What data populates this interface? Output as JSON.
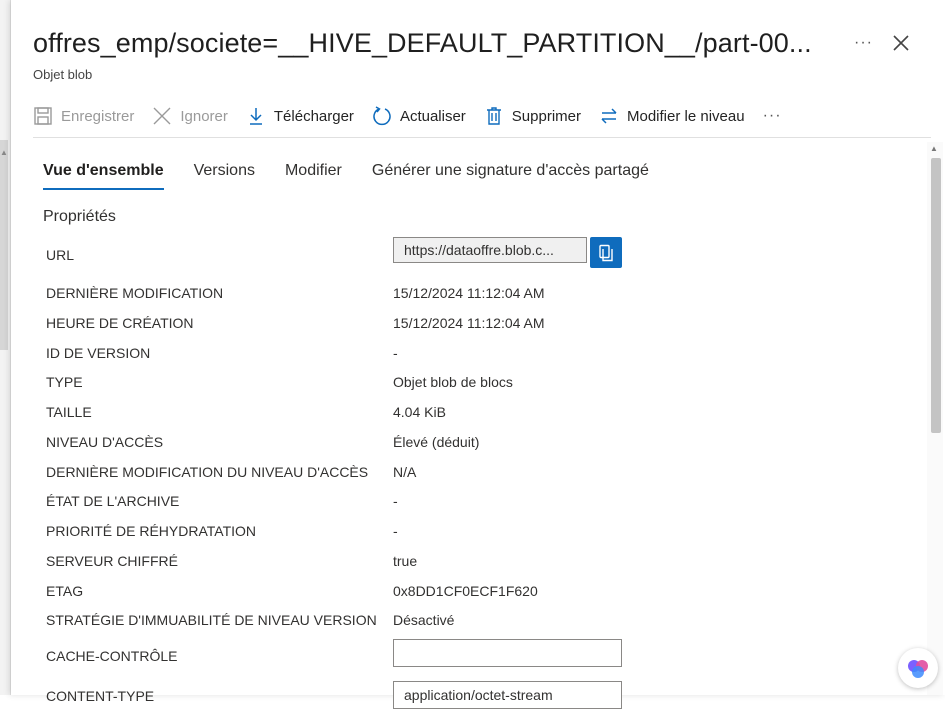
{
  "window": {
    "title": "offres_emp/societe=__HIVE_DEFAULT_PARTITION__/part-00...",
    "subtitle": "Objet blob"
  },
  "toolbar": {
    "save_label": "Enregistrer",
    "discard_label": "Ignorer",
    "download_label": "Télécharger",
    "refresh_label": "Actualiser",
    "delete_label": "Supprimer",
    "change_tier_label": "Modifier le niveau"
  },
  "tabs": [
    {
      "label": "Vue d'ensemble",
      "active": true
    },
    {
      "label": "Versions",
      "active": false
    },
    {
      "label": "Modifier",
      "active": false
    },
    {
      "label": "Générer une signature d'accès partagé",
      "active": false
    }
  ],
  "section_title": "Propriétés",
  "properties": {
    "url": {
      "label": "URL",
      "value": "https://dataoffre.blob.c..."
    },
    "last_modified": {
      "label": "DERNIÈRE MODIFICATION",
      "value": "15/12/2024 11:12:04 AM"
    },
    "creation_time": {
      "label": "HEURE DE CRÉATION",
      "value": "15/12/2024 11:12:04 AM"
    },
    "version_id": {
      "label": "ID DE VERSION",
      "value": "-"
    },
    "type": {
      "label": "TYPE",
      "value": "Objet blob de blocs"
    },
    "size": {
      "label": "TAILLE",
      "value": "4.04 KiB"
    },
    "access_tier": {
      "label": "NIVEAU D'ACCÈS",
      "value": "Élevé (déduit)"
    },
    "tier_last_modified": {
      "label": "DERNIÈRE MODIFICATION DU NIVEAU D'ACCÈS",
      "value": "N/A"
    },
    "archive_status": {
      "label": "ÉTAT DE L'ARCHIVE",
      "value": "-"
    },
    "rehydrate_priority": {
      "label": "PRIORITÉ DE RÉHYDRATATION",
      "value": "-"
    },
    "server_encrypted": {
      "label": "SERVEUR CHIFFRÉ",
      "value": "true"
    },
    "etag": {
      "label": "ETAG",
      "value": "0x8DD1CF0ECF1F620"
    },
    "immutability": {
      "label": "STRATÉGIE D'IMMUABILITÉ DE NIVEAU VERSION",
      "value": "Désactivé"
    },
    "cache_control": {
      "label": "CACHE-CONTRÔLE",
      "value": ""
    },
    "content_type": {
      "label": "CONTENT-TYPE",
      "value": "application/octet-stream"
    }
  },
  "colors": {
    "accent": "#0f6cbd",
    "disabled": "#9a9a9a"
  },
  "icons": [
    "save-icon",
    "discard-icon",
    "download-icon",
    "refresh-icon",
    "delete-icon",
    "change-tier-icon",
    "copy-icon",
    "close-icon",
    "more-icon",
    "copilot-icon"
  ]
}
